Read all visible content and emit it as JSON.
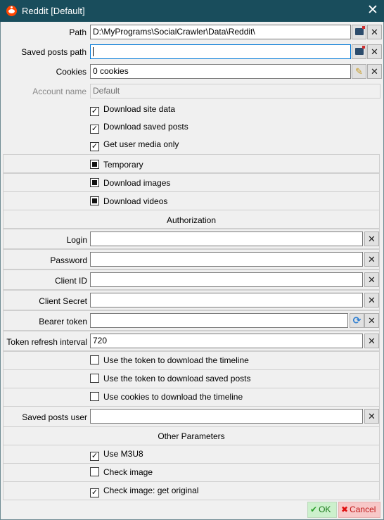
{
  "window": {
    "title": "Reddit [Default]",
    "close": "✕"
  },
  "fields": {
    "path": {
      "label": "Path",
      "value": "D:\\MyPrograms\\SocialCrawler\\Data\\Reddit\\"
    },
    "saved_posts_path": {
      "label": "Saved posts path",
      "value": ""
    },
    "cookies": {
      "label": "Cookies",
      "value": "0 cookies"
    },
    "account_name": {
      "label": "Account name",
      "value": "Default"
    }
  },
  "checkboxes_top": [
    {
      "label": "Download site data",
      "checked": true
    },
    {
      "label": "Download saved posts",
      "checked": true
    },
    {
      "label": "Get user media only",
      "checked": true
    }
  ],
  "tristate": [
    {
      "label": "Temporary"
    },
    {
      "label": "Download images"
    },
    {
      "label": "Download videos"
    }
  ],
  "authorization": {
    "header": "Authorization",
    "login": {
      "label": "Login",
      "value": ""
    },
    "password": {
      "label": "Password",
      "value": ""
    },
    "client_id": {
      "label": "Client ID",
      "value": ""
    },
    "client_secret": {
      "label": "Client Secret",
      "value": ""
    },
    "bearer_token": {
      "label": "Bearer token",
      "value": ""
    },
    "token_refresh": {
      "label": "Token refresh interval",
      "value": "720"
    },
    "options": [
      {
        "label": "Use the token to download the timeline",
        "checked": false
      },
      {
        "label": "Use the token to download saved posts",
        "checked": false
      },
      {
        "label": "Use cookies to download the timeline",
        "checked": false
      }
    ],
    "saved_posts_user": {
      "label": "Saved posts user",
      "value": ""
    }
  },
  "other": {
    "header": "Other Parameters",
    "options": [
      {
        "label": "Use M3U8",
        "checked": true
      },
      {
        "label": "Check image",
        "checked": false
      },
      {
        "label": "Check image: get original",
        "checked": true
      }
    ]
  },
  "buttons": {
    "ok": "OK",
    "cancel": "Cancel",
    "check_glyph": "✓"
  },
  "icons": {
    "clear": "✕",
    "pencil": "✎",
    "refresh": "⟳",
    "ok_check": "✔",
    "cancel_x": "✖"
  },
  "colors": {
    "titlebar": "#194d5c",
    "ok_bg": "#ccf0cc",
    "cancel_bg": "#f7c8c8"
  }
}
